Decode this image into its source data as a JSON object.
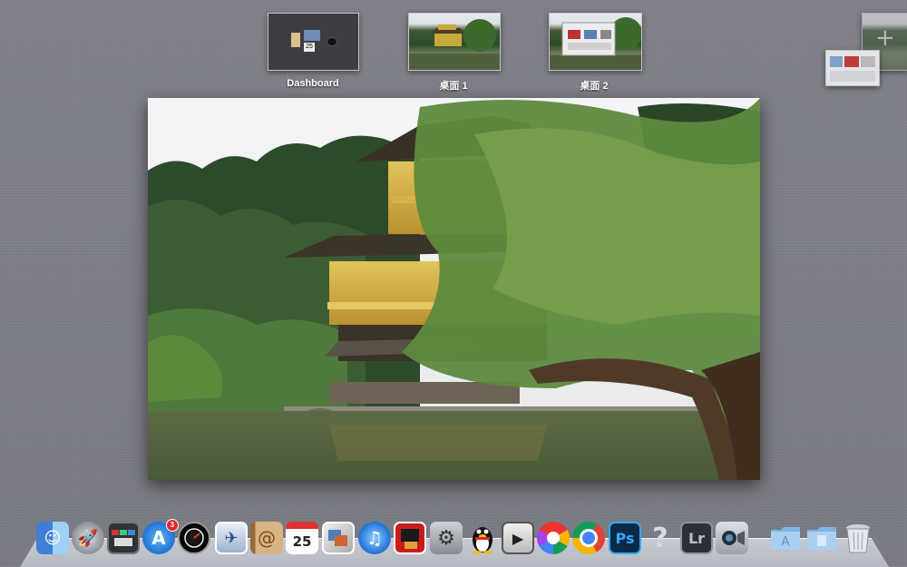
{
  "spaces": [
    {
      "label": "Dashboard",
      "kind": "dashboard",
      "calendar_day": "25"
    },
    {
      "label": "桌面 1",
      "kind": "desktop"
    },
    {
      "label": "桌面 2",
      "kind": "desktop-window"
    }
  ],
  "add_space": {
    "glyph": "+"
  },
  "dock": {
    "items": [
      {
        "name": "finder-icon",
        "glyph": ""
      },
      {
        "name": "launchpad-icon",
        "glyph": "🚀"
      },
      {
        "name": "mission-control-icon",
        "glyph": ""
      },
      {
        "name": "app-store-icon",
        "glyph": "A",
        "badge": "3"
      },
      {
        "name": "dashboard-icon",
        "glyph": ""
      },
      {
        "name": "mail-icon",
        "glyph": "✈"
      },
      {
        "name": "contacts-icon",
        "glyph": "@"
      },
      {
        "name": "calendar-icon",
        "glyph": "25"
      },
      {
        "name": "photo-booth-icon",
        "glyph": ""
      },
      {
        "name": "itunes-icon",
        "glyph": "♫"
      },
      {
        "name": "photo-slideshow-icon",
        "glyph": ""
      },
      {
        "name": "system-preferences-icon",
        "glyph": "⚙"
      },
      {
        "name": "qq-penguin-icon",
        "glyph": ""
      },
      {
        "name": "dvd-player-icon",
        "glyph": "▶"
      },
      {
        "name": "picasa-icon",
        "glyph": ""
      },
      {
        "name": "chrome-icon",
        "glyph": ""
      },
      {
        "name": "photoshop-icon",
        "glyph": "Ps"
      },
      {
        "name": "unknown-app-icon",
        "glyph": "?"
      },
      {
        "name": "lightroom-icon",
        "glyph": "Lr"
      },
      {
        "name": "facetime-icon",
        "glyph": ""
      },
      {
        "name": "applications-folder-icon",
        "glyph": ""
      },
      {
        "name": "documents-folder-icon",
        "glyph": ""
      },
      {
        "name": "trash-icon",
        "glyph": ""
      }
    ]
  }
}
